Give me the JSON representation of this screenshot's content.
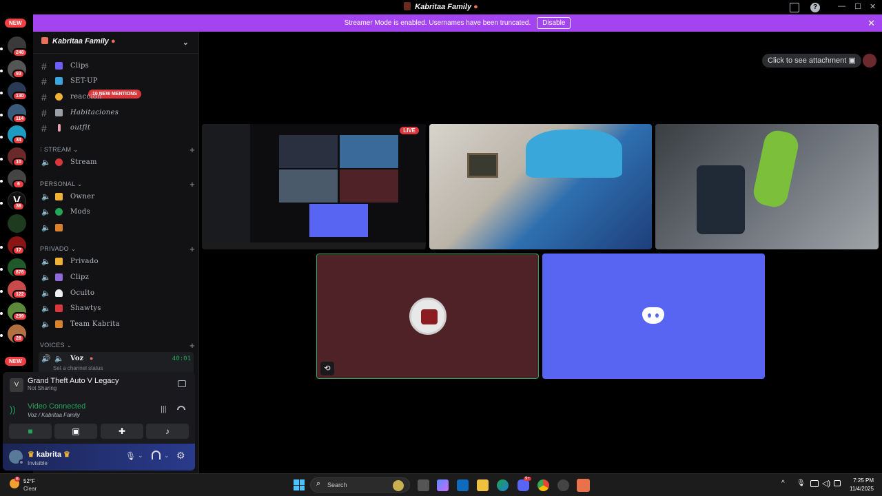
{
  "window": {
    "title": "Kabritaa Family",
    "minimize": "—",
    "maximize": "☐",
    "close": "✕"
  },
  "streamer_banner": {
    "message": "Streamer Mode is enabled. Usernames have been truncated.",
    "button": "Disable",
    "close": "✕"
  },
  "guilds": {
    "new_top": "NEW",
    "new_bottom": "NEW",
    "badges": [
      "248",
      "93",
      "130",
      "114",
      "34",
      "10",
      "6",
      "36",
      "17",
      "876",
      "122",
      "299",
      "28"
    ]
  },
  "server": {
    "name": "Kabritaa Family"
  },
  "mentions_pill": "10 NEW MENTIONS",
  "text_channels": [
    {
      "name": "Clips",
      "icon_color": "#6d5dfc"
    },
    {
      "name": "SET-UP",
      "icon_color": "#3ba5e0"
    },
    {
      "name": "reaccion",
      "icon_color": "#f0b232"
    },
    {
      "name": "Habitaciones",
      "icon_color": "#9aa0a6"
    },
    {
      "name": "outfit",
      "icon_color": "#e7a1b0"
    }
  ],
  "categories": {
    "stream": "STREAM",
    "personal": "PERSONAL",
    "privado": "PRIVADO",
    "voices": "VOICES"
  },
  "stream_channels": [
    {
      "name": "Stream",
      "icon_color": "#da373c"
    }
  ],
  "personal_channels": [
    {
      "name": "Owner",
      "icon_color": "#f0b232"
    },
    {
      "name": "Mods",
      "icon_color": "#23a55a"
    },
    {
      "name": "",
      "icon_color": "#d9822b"
    }
  ],
  "privado_channels": [
    {
      "name": "Privado",
      "icon_color": "#f0b232"
    },
    {
      "name": "Clipz",
      "icon_color": "#8e6bd8"
    },
    {
      "name": "Oculto",
      "icon_color": "#eeeeee"
    },
    {
      "name": "Shawtys",
      "icon_color": "#da373c"
    },
    {
      "name": "Team Kabrita",
      "icon_color": "#d9822b"
    }
  ],
  "voice_channel": {
    "name": "Voz",
    "timer": "40:01",
    "status_placeholder": "Set a channel status"
  },
  "activity": {
    "game": "Grand Theft Auto V Legacy",
    "sharing": "Not Sharing"
  },
  "connection": {
    "status": "Video Connected",
    "location": "Voz / Kabritaa Family"
  },
  "user": {
    "name": "kabrita",
    "status": "Invisible"
  },
  "stage": {
    "attachment_button": "Click to see attachment",
    "live_badge": "LIVE"
  },
  "taskbar": {
    "weather_temp": "52°F",
    "weather_desc": "Clear",
    "weather_badge": "8",
    "search": "Search",
    "time": "7:25 PM",
    "date": "11/4/2025",
    "discord_badge": "9+"
  },
  "colors": {
    "streamer_banner": "#a443f0",
    "blurple": "#5865f2",
    "connected_green": "#23a55a",
    "tile_maroon": "#4e2226"
  }
}
